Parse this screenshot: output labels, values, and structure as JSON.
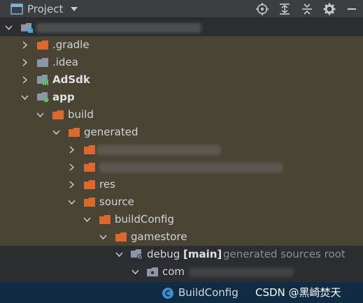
{
  "header": {
    "title": "Project"
  },
  "tree": [
    {
      "label": "",
      "redacted": true
    },
    {
      "label": ".gradle"
    },
    {
      "label": ".idea"
    },
    {
      "label": "AdSdk"
    },
    {
      "label": "app"
    },
    {
      "label": "build"
    },
    {
      "label": "generated"
    },
    {
      "label": "",
      "redacted": true
    },
    {
      "label": "",
      "redacted": true
    },
    {
      "label": "res"
    },
    {
      "label": "source"
    },
    {
      "label": "buildConfig"
    },
    {
      "label": "gamestore"
    },
    {
      "label": "debug",
      "bracket": "[main]",
      "suffix": "generated sources root"
    },
    {
      "label": "com",
      "redacted_suffix": true
    }
  ],
  "status": {
    "label": "BuildConfig"
  },
  "watermark": "CSDN @黑崎焚天",
  "colors": {
    "folder": "#d9692f",
    "module_folder": "#8b97a6",
    "highlight": "#4a4435",
    "status_bar": "#0f2c44"
  }
}
